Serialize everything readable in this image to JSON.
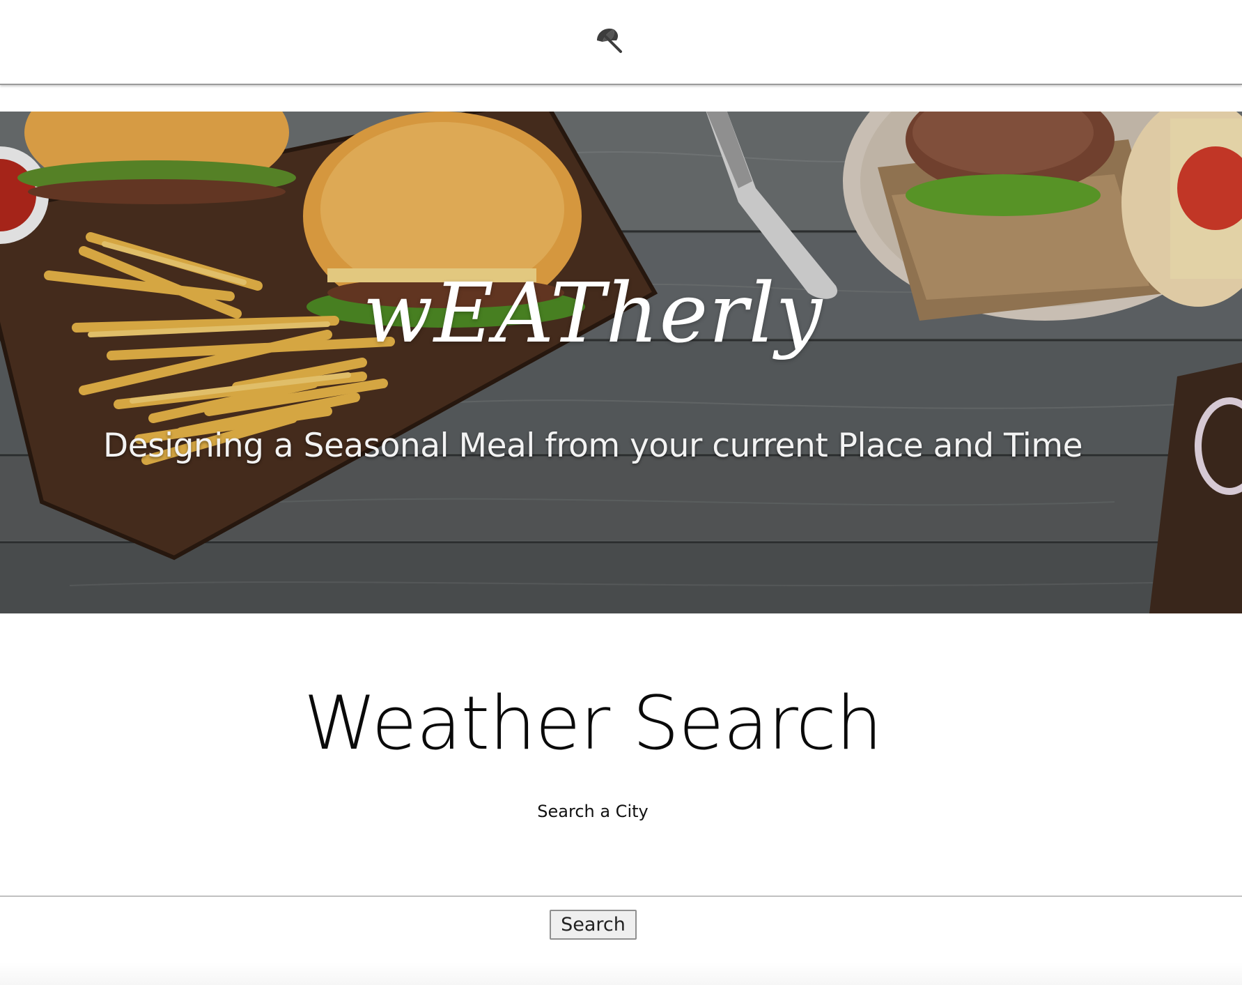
{
  "nav": {
    "logo_icon": "umbrella-icon"
  },
  "hero": {
    "title": "wEATherly",
    "subtitle": "Designing a Seasonal Meal from your current Place and Time"
  },
  "weather_search": {
    "title": "Weather Search",
    "label": "Search a City",
    "input_value": "",
    "input_placeholder": "",
    "button_label": "Search"
  },
  "colors": {
    "background": "#ffffff",
    "text": "#0a0a0a",
    "hero_text": "#ffffff",
    "wood": "#5c5f60"
  }
}
